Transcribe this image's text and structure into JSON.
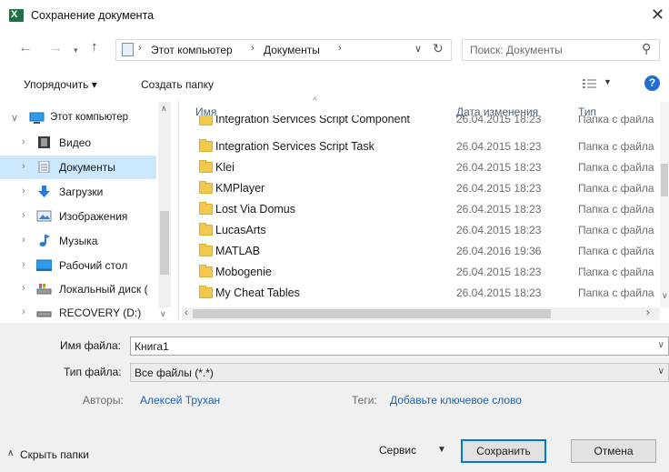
{
  "window": {
    "title": "Сохранение документа",
    "app_icon": "excel-icon",
    "close_symbol": "✕"
  },
  "address_bar": {
    "crumbs": [
      "Этот компьютер",
      "Документы"
    ],
    "search_placeholder": "Поиск: Документы"
  },
  "toolbar": {
    "organize_label": "Упорядочить ▾",
    "new_folder_label": "Создать папку",
    "help_label": "?"
  },
  "nav_tree": [
    {
      "label": "Этот компьютер",
      "icon": "pc-icon",
      "expanded": true,
      "selected": false
    },
    {
      "label": "Видео",
      "icon": "video-icon",
      "expanded": false,
      "selected": false
    },
    {
      "label": "Документы",
      "icon": "documents-icon",
      "expanded": false,
      "selected": true
    },
    {
      "label": "Загрузки",
      "icon": "downloads-icon",
      "expanded": false,
      "selected": false
    },
    {
      "label": "Изображения",
      "icon": "pictures-icon",
      "expanded": false,
      "selected": false
    },
    {
      "label": "Музыка",
      "icon": "music-icon",
      "expanded": false,
      "selected": false
    },
    {
      "label": "Рабочий стол",
      "icon": "desktop-icon",
      "expanded": false,
      "selected": false
    },
    {
      "label": "Локальный диск (",
      "icon": "local-disk-icon",
      "expanded": false,
      "selected": false
    },
    {
      "label": "RECOVERY (D:)",
      "icon": "drive-icon",
      "expanded": false,
      "selected": false
    }
  ],
  "file_list": {
    "columns": {
      "name": "Имя",
      "date": "Дата изменения",
      "type": "Тип"
    },
    "rows": [
      {
        "name": "Integration Services Script Component",
        "date": "26.04.2015 18:23",
        "type": "Папка с файла"
      },
      {
        "name": "Integration Services Script Task",
        "date": "26.04.2015 18:23",
        "type": "Папка с файла"
      },
      {
        "name": "Klei",
        "date": "26.04.2015 18:23",
        "type": "Папка с файла"
      },
      {
        "name": "KMPlayer",
        "date": "26.04.2015 18:23",
        "type": "Папка с файла"
      },
      {
        "name": "Lost Via Domus",
        "date": "26.04.2015 18:23",
        "type": "Папка с файла"
      },
      {
        "name": "LucasArts",
        "date": "26.04.2015 18:23",
        "type": "Папка с файла"
      },
      {
        "name": "MATLAB",
        "date": "26.04.2016 19:36",
        "type": "Папка с файла"
      },
      {
        "name": "Mobogenie",
        "date": "26.04.2015 18:23",
        "type": "Папка с файла"
      },
      {
        "name": "My Cheat Tables",
        "date": "26.04.2015 18:23",
        "type": "Папка с файла"
      }
    ]
  },
  "form": {
    "filename_label": "Имя файла:",
    "filename_value": "Книга1",
    "filetype_label": "Тип файла:",
    "filetype_value": "Все файлы (*.*)",
    "authors_label": "Авторы:",
    "authors_value": "Алексей Трухан",
    "tags_label": "Теги:",
    "tags_value": "Добавьте ключевое слово"
  },
  "footer": {
    "hide_folders_label": "Скрыть папки",
    "service_label": "Сервис",
    "save_label": "Сохранить",
    "cancel_label": "Отмена"
  },
  "colors": {
    "accent": "#0078d7",
    "selection": "#cce8ff",
    "link": "#1c62b9",
    "folder": "#f2c94c",
    "excel": "#1e7145"
  }
}
